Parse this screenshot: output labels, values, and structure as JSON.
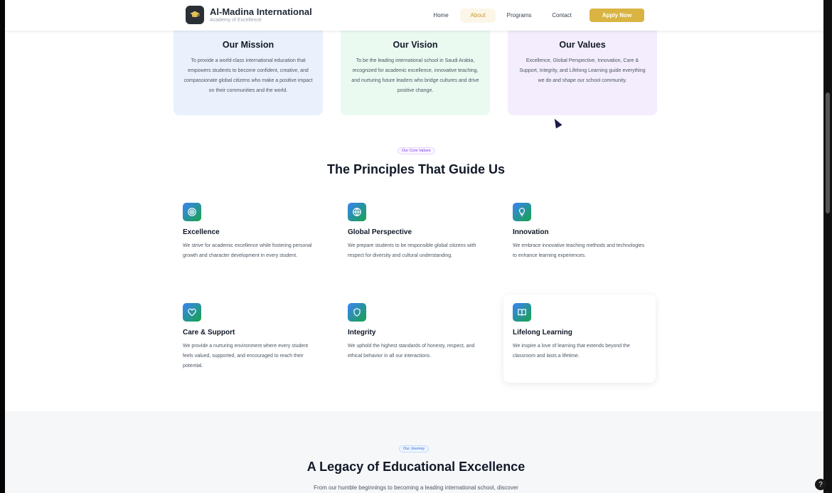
{
  "nav": {
    "brand_name": "Al-Madina International",
    "brand_tagline": "Academy of Excellence",
    "links": [
      "Home",
      "About",
      "Programs",
      "Contact"
    ],
    "active_link": "About",
    "apply_label": "Apply Now",
    "logo_icon": "graduation-cap-icon"
  },
  "mission_cards": [
    {
      "title": "Our Mission",
      "text": "To provide a world-class international education that empowers students to become confident, creative, and compassionate global citizens who make a positive impact on their communities and the world.",
      "bg": "#eaf1fd"
    },
    {
      "title": "Our Vision",
      "text": "To be the leading international school in Saudi Arabia, recognized for academic excellence, innovative teaching, and nurturing future leaders who bridge cultures and drive positive change.",
      "bg": "#eafaf0"
    },
    {
      "title": "Our Values",
      "text": "Excellence, Global Perspective, Innovation, Care & Support, Integrity, and Lifelong Learning guide everything we do and shape our school community.",
      "bg": "#f3edfd"
    }
  ],
  "principles": {
    "badge": "Our Core Values",
    "heading": "The Principles That Guide Us",
    "cards": [
      {
        "title": "Excellence",
        "icon": "target-icon",
        "text": "We strive for academic excellence while fostering personal growth and character development in every student."
      },
      {
        "title": "Global Perspective",
        "icon": "globe-icon",
        "text": "We prepare students to be responsible global citizens with respect for diversity and cultural understanding."
      },
      {
        "title": "Innovation",
        "icon": "lightbulb-icon",
        "text": "We embrace innovative teaching methods and technologies to enhance learning experiences."
      },
      {
        "title": "Care & Support",
        "icon": "heart-icon",
        "text": "We provide a nurturing environment where every student feels valued, supported, and encouraged to reach their potential."
      },
      {
        "title": "Integrity",
        "icon": "shield-icon",
        "text": "We uphold the highest standards of honesty, respect, and ethical behavior in all our interactions."
      },
      {
        "title": "Lifelong Learning",
        "icon": "book-open-icon",
        "text": "We inspire a love of learning that extends beyond the classroom and lasts a lifetime."
      }
    ]
  },
  "journey": {
    "badge": "Our Journey",
    "heading": "A Legacy of Educational Excellence",
    "text": "From our humble beginnings to becoming a leading international school, discover"
  },
  "help_label": "?",
  "accent_color": "#d9b443"
}
